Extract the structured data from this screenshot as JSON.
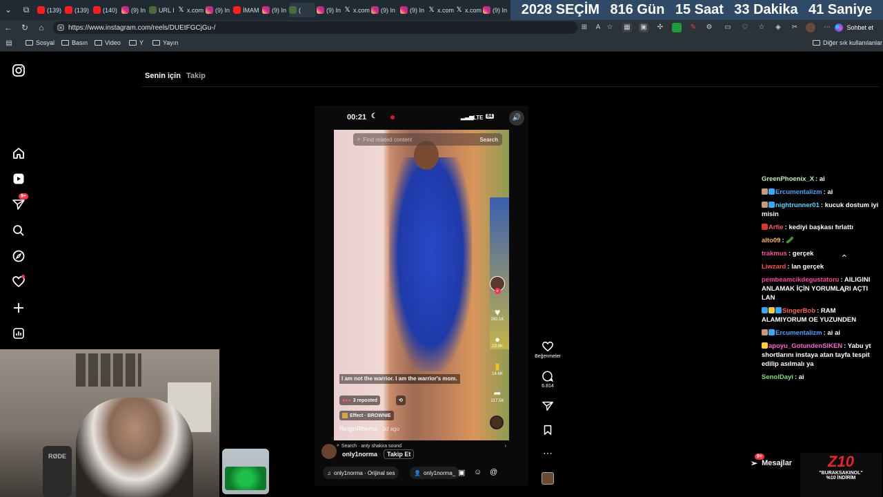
{
  "tabs": [
    {
      "icon": "youtube",
      "label": "(139)"
    },
    {
      "icon": "youtube",
      "label": "(139)"
    },
    {
      "icon": "youtube",
      "label": "(140)"
    },
    {
      "icon": "instagram",
      "label": "(9) In"
    },
    {
      "icon": "generic",
      "label": "URL I"
    },
    {
      "icon": "x",
      "label": "x.com"
    },
    {
      "icon": "instagram",
      "label": "(9) In"
    },
    {
      "icon": "youtube",
      "label": "İMAM"
    },
    {
      "icon": "instagram",
      "label": "(9) In"
    },
    {
      "icon": "generic",
      "label": "("
    },
    {
      "icon": "instagram",
      "label": "(9) In"
    },
    {
      "icon": "x",
      "label": "x.com"
    },
    {
      "icon": "instagram",
      "label": "(9) In"
    },
    {
      "icon": "instagram",
      "label": "(9) In"
    },
    {
      "icon": "x",
      "label": "x.com"
    },
    {
      "icon": "x",
      "label": "x.com"
    },
    {
      "icon": "instagram",
      "label": "(9) In"
    }
  ],
  "countdown": {
    "prefix": "2028 SEÇİM",
    "days": "816 Gün",
    "hours": "15 Saat",
    "minutes": "33 Dakika",
    "seconds": "41 Saniye"
  },
  "address_bar": {
    "url": "https://www.instagram.com/reels/DUEtFGCjGu-/",
    "chat_label": "Sohbet et"
  },
  "bookmarks": {
    "items": [
      "Sosyal",
      "Basın",
      "Video",
      "Y",
      "Yayın"
    ],
    "other": "Diğer sık kullanılanlar"
  },
  "feed_tabs": {
    "for_you": "Senin için",
    "following": "Takip"
  },
  "sidebar_badge": "9+",
  "reel": {
    "status_time": "00:21",
    "status_network": "LTE",
    "status_battery": "84",
    "search_placeholder": "Find related content",
    "search_button": "Search",
    "caption": "I am not the warrior. I am the warrior's mom.",
    "reposted": "3 reposted",
    "effect": "Effect · BROWNIE",
    "author": "ReignRhema",
    "author_age": "· 3d ago",
    "inner_likes": "263.1K",
    "inner_comments": "23.9K",
    "inner_saves": "14.6K",
    "inner_shares": "217.5K",
    "sound_search": "Search · anty shakira sound",
    "owner": "only1norma",
    "follow": "Takip Et",
    "audio": "only1norma · Orijinal ses",
    "tagged": "only1norma_"
  },
  "actions": {
    "likes_label": "Beğenmeler",
    "comments": "6.814"
  },
  "chat": [
    {
      "user": "GreenPhoenix_X",
      "color": "#b9f3b0",
      "text": "ai",
      "badges": []
    },
    {
      "user": "Ercumentalizm",
      "color": "#4aa3ff",
      "text": "ai",
      "badges": [
        "#c97",
        "#3af"
      ]
    },
    {
      "user": "nightrunner01",
      "color": "#49d9ff",
      "text": "kucuk dostum iyi misin",
      "badges": [
        "#c97",
        "#3af"
      ]
    },
    {
      "user": "Arfie",
      "color": "#ff5a5a",
      "text": "kediyi başkası fırlattı",
      "badges": [
        "#d33"
      ]
    },
    {
      "user": "alto09",
      "color": "#ffb347",
      "text": "🥒",
      "badges": []
    },
    {
      "user": "trakmus",
      "color": "#ff4fa0",
      "text": "gerçek",
      "badges": []
    },
    {
      "user": "Liwzard",
      "color": "#ff4f4f",
      "text": "lan gerçek",
      "badges": []
    },
    {
      "user": "pembeamcikdegustatoru",
      "color": "#ff3fa0",
      "text": "AILIGINI ANLAMAK İÇİN YORUMLARI AÇTI LAN",
      "badges": []
    },
    {
      "user": "SingerBob",
      "color": "#ff5f5f",
      "text": "RAM ALAMIYORUM OE YUZUNDEN",
      "badges": [
        "#3af",
        "#fc3",
        "#3af"
      ]
    },
    {
      "user": "Ercumentalizm",
      "color": "#4aa3ff",
      "text": "ai ai",
      "badges": [
        "#c97",
        "#3af"
      ]
    },
    {
      "user": "apoyu_GotundenSIKEN",
      "color": "#ff5fd0",
      "text": "Yabu yt shortlarını instaya atan tayfa tespit edilip asılmalı ya",
      "badges": [
        "#fc3"
      ]
    },
    {
      "user": "SenolDayi",
      "color": "#7ee07e",
      "text": "ai",
      "badges": []
    }
  ],
  "messages": {
    "label": "Mesajlar",
    "badge": "9+"
  },
  "promo": {
    "brand": "Z10",
    "line1": "\"BURAKSAKINOL\"",
    "line2": "%10 İNDİRİM"
  },
  "colors": {
    "countdown_bg": "#2f4a66",
    "chrome_bg": "#2b3238",
    "tab_strip": "#1f2a33",
    "accent_red": "#ff3040"
  }
}
